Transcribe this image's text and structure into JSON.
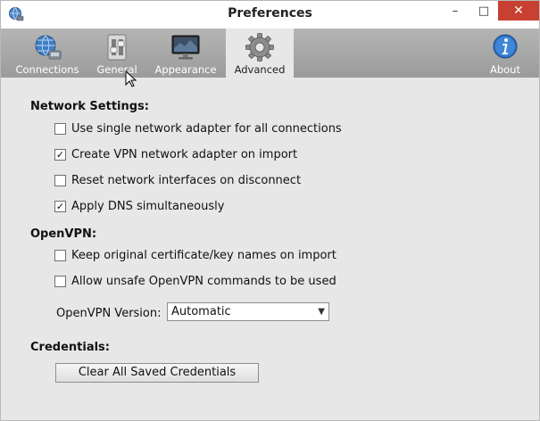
{
  "window": {
    "title": "Preferences"
  },
  "window_controls": {
    "minimize": "–",
    "maximize": "□",
    "close": "✕"
  },
  "tabs": [
    {
      "label": "Connections",
      "icon": "globe-network-icon"
    },
    {
      "label": "General",
      "icon": "switch-toggle-icon"
    },
    {
      "label": "Appearance",
      "icon": "monitor-display-icon"
    },
    {
      "label": "Advanced",
      "icon": "gear-icon",
      "active": true
    },
    {
      "label": "About",
      "icon": "info-icon"
    }
  ],
  "network": {
    "heading": "Network Settings:",
    "options": [
      {
        "label": "Use single network adapter for all connections",
        "checked": false
      },
      {
        "label": "Create VPN network adapter on import",
        "checked": true
      },
      {
        "label": "Reset network interfaces on disconnect",
        "checked": false
      },
      {
        "label": "Apply DNS simultaneously",
        "checked": true
      }
    ]
  },
  "openvpn": {
    "heading": "OpenVPN:",
    "options": [
      {
        "label": "Keep original certificate/key names on import",
        "checked": false
      },
      {
        "label": "Allow unsafe OpenVPN commands to be used",
        "checked": false
      }
    ],
    "version_label": "OpenVPN Version:",
    "version_value": "Automatic"
  },
  "credentials": {
    "heading": "Credentials:",
    "clear_button": "Clear All Saved Credentials"
  },
  "colors": {
    "toolbar": "#a8a8a8",
    "background": "#e7e7e7",
    "close_button": "#c84031"
  }
}
